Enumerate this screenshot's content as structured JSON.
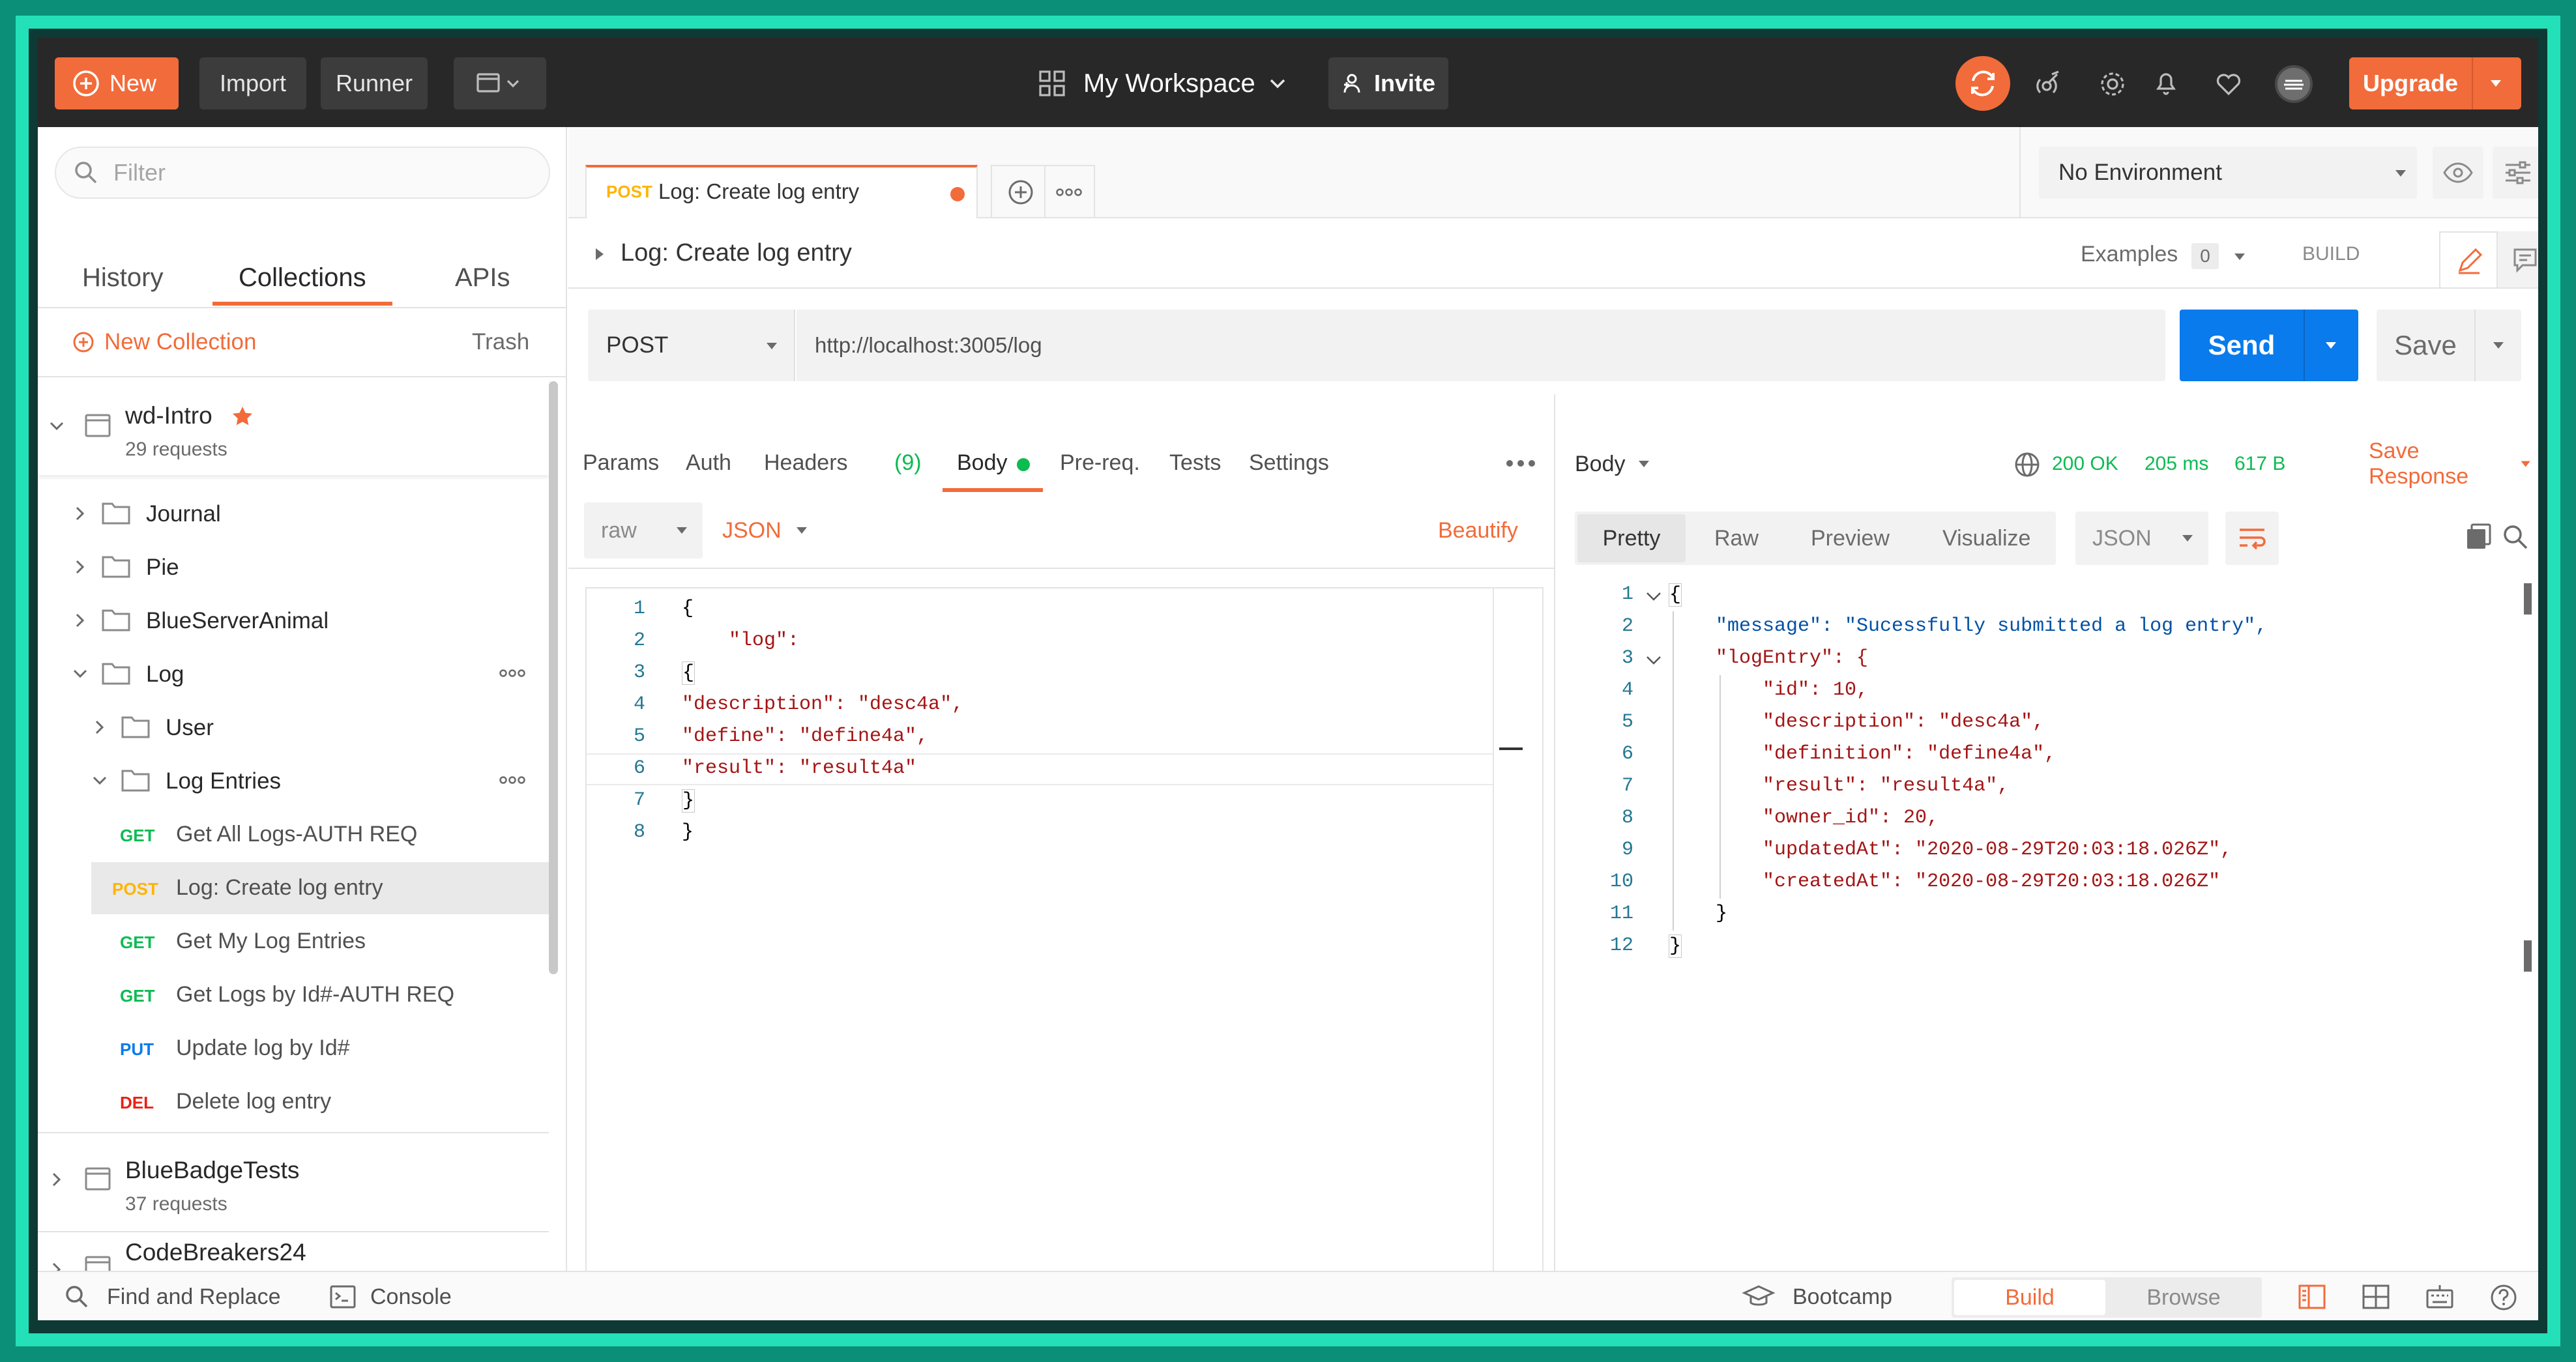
{
  "header": {
    "new_label": "New",
    "import_label": "Import",
    "runner_label": "Runner",
    "workspace_label": "My Workspace",
    "invite_label": "Invite",
    "upgrade_label": "Upgrade"
  },
  "sidebar": {
    "filter_placeholder": "Filter",
    "tabs": [
      {
        "label": "History"
      },
      {
        "label": "Collections"
      },
      {
        "label": "APIs"
      }
    ],
    "new_collection_label": "New Collection",
    "trash_label": "Trash",
    "collections": [
      {
        "name": "wd-Intro",
        "count": "29 requests"
      },
      {
        "name": "BlueBadgeTests",
        "count": "37 requests"
      },
      {
        "name": "CodeBreakers24"
      }
    ],
    "folders": [
      {
        "label": "Journal"
      },
      {
        "label": "Pie"
      },
      {
        "label": "BlueServerAnimal"
      },
      {
        "label": "Log"
      },
      {
        "label": "User"
      },
      {
        "label": "Log Entries"
      }
    ],
    "requests": [
      {
        "method": "GET",
        "label": "Get All Logs-AUTH REQ"
      },
      {
        "method": "POST",
        "label": "Log: Create log entry"
      },
      {
        "method": "GET",
        "label": "Get My Log Entries"
      },
      {
        "method": "GET",
        "label": "Get Logs by Id#-AUTH REQ"
      },
      {
        "method": "PUT",
        "label": "Update log by Id#"
      },
      {
        "method": "DEL",
        "label": "Delete log entry"
      }
    ]
  },
  "tab": {
    "method": "POST",
    "title": "Log: Create log entry"
  },
  "environment": {
    "selected": "No Environment"
  },
  "request": {
    "name": "Log: Create log entry",
    "examples_label": "Examples",
    "examples_count": "0",
    "build_label": "BUILD",
    "method": "POST",
    "url": "http://localhost:3005/log",
    "send_label": "Send",
    "save_label": "Save",
    "subtabs": [
      {
        "label": "Params"
      },
      {
        "label": "Auth"
      },
      {
        "label": "Headers"
      },
      {
        "label": "Body"
      },
      {
        "label": "Pre-req."
      },
      {
        "label": "Tests"
      },
      {
        "label": "Settings"
      }
    ],
    "headers_count": "(9)",
    "body_mode": "raw",
    "body_format": "JSON",
    "beautify_label": "Beautify",
    "body_lines": [
      {
        "n": "1",
        "text": "{"
      },
      {
        "n": "2",
        "text": "    \"log\":"
      },
      {
        "n": "3",
        "text": "{"
      },
      {
        "n": "4",
        "text": "\"description\": \"desc4a\","
      },
      {
        "n": "5",
        "text": "\"define\": \"define4a\","
      },
      {
        "n": "6",
        "text": "\"result\": \"result4a\""
      },
      {
        "n": "7",
        "text": "}"
      },
      {
        "n": "8",
        "text": "}"
      }
    ]
  },
  "response": {
    "body_label": "Body",
    "status": "200 OK",
    "time": "205 ms",
    "size": "617 B",
    "save_response_label": "Save Response",
    "view_tabs": [
      {
        "label": "Pretty"
      },
      {
        "label": "Raw"
      },
      {
        "label": "Preview"
      },
      {
        "label": "Visualize"
      }
    ],
    "format": "JSON",
    "lines": [
      {
        "n": "1",
        "text": "{"
      },
      {
        "n": "2",
        "text": "    \"message\": \"Sucessfully submitted a log entry\","
      },
      {
        "n": "3",
        "text": "    \"logEntry\": {"
      },
      {
        "n": "4",
        "text": "        \"id\": 10,"
      },
      {
        "n": "5",
        "text": "        \"description\": \"desc4a\","
      },
      {
        "n": "6",
        "text": "        \"definition\": \"define4a\","
      },
      {
        "n": "7",
        "text": "        \"result\": \"result4a\","
      },
      {
        "n": "8",
        "text": "        \"owner_id\": 20,"
      },
      {
        "n": "9",
        "text": "        \"updatedAt\": \"2020-08-29T20:03:18.026Z\","
      },
      {
        "n": "10",
        "text": "        \"createdAt\": \"2020-08-29T20:03:18.026Z\""
      },
      {
        "n": "11",
        "text": "    }"
      },
      {
        "n": "12",
        "text": "}"
      }
    ]
  },
  "footer": {
    "find_replace_label": "Find and Replace",
    "console_label": "Console",
    "bootcamp_label": "Bootcamp",
    "build_label": "Build",
    "browse_label": "Browse"
  },
  "colors": {
    "accent": "#f26b3a",
    "send_blue": "#097bed",
    "get_green": "#0cbb52",
    "post_orange": "#ffb400",
    "put_blue": "#097bed",
    "del_red": "#eb2013",
    "status_green": "#0cbb52",
    "json_key": "#a31515",
    "json_string": "#0451a5",
    "json_number": "#098658"
  }
}
